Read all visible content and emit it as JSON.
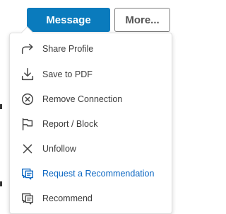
{
  "colors": {
    "primary_button_bg": "#0a7bbd",
    "accent_text": "#0a66c2",
    "menu_text": "#3b3b3b"
  },
  "actions": {
    "message_label": "Message",
    "more_label": "More..."
  },
  "menu": {
    "items": [
      {
        "label": "Share Profile",
        "icon": "share-arrow-icon",
        "active": false
      },
      {
        "label": "Save to PDF",
        "icon": "download-icon",
        "active": false
      },
      {
        "label": "Remove Connection",
        "icon": "circle-x-icon",
        "active": false
      },
      {
        "label": "Report / Block",
        "icon": "flag-icon",
        "active": false
      },
      {
        "label": "Unfollow",
        "icon": "x-icon",
        "active": false
      },
      {
        "label": "Request a Recommendation",
        "icon": "recommendation-request-icon",
        "active": true
      },
      {
        "label": "Recommend",
        "icon": "recommend-icon",
        "active": false
      }
    ]
  }
}
